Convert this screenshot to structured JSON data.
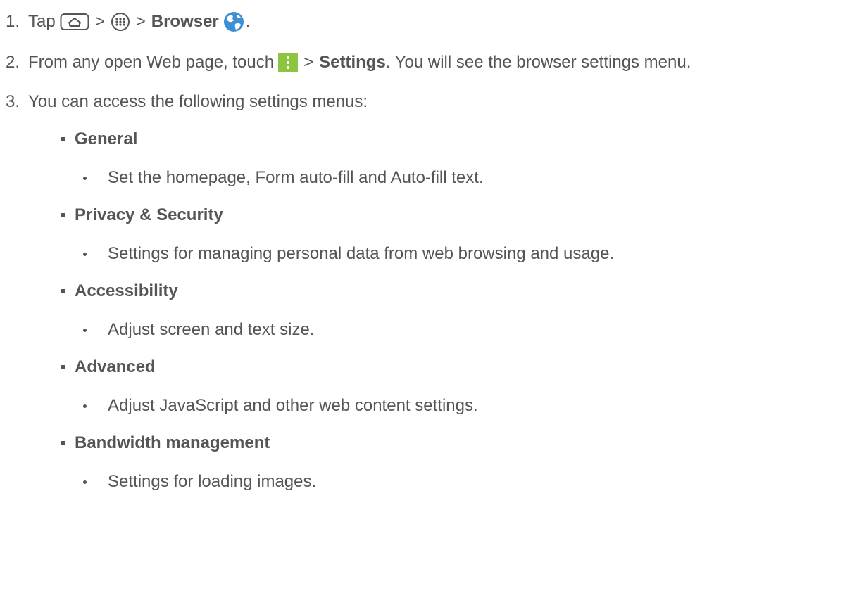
{
  "steps": [
    {
      "number": "1.",
      "tap": "Tap",
      "sep1": ">",
      "sep2": ">",
      "app_label": "Browser",
      "end": "."
    },
    {
      "number": "2.",
      "pre": "From any open Web page, touch",
      "sep": ">",
      "settings_label": "Settings",
      "post": ". You will see the browser settings menu."
    },
    {
      "number": "3.",
      "text": "You can access the following settings menus:"
    }
  ],
  "menus": [
    {
      "title": "General",
      "desc": "Set the homepage, Form auto-fill and Auto-fill text."
    },
    {
      "title": "Privacy & Security",
      "desc": "Settings for managing personal data from web browsing and usage."
    },
    {
      "title": "Accessibility",
      "desc": "Adjust screen and text size."
    },
    {
      "title": "Advanced",
      "desc": "Adjust JavaScript and other web content settings."
    },
    {
      "title": "Bandwidth management",
      "desc": "Settings for loading images."
    }
  ],
  "icons": {
    "home": "home-key-icon",
    "apps": "apps-icon",
    "browser": "browser-globe-icon",
    "menu": "menu-icon"
  },
  "colors": {
    "text": "#555555",
    "menu_icon_bg": "#8cc63f",
    "globe_blue": "#3c8fd6"
  }
}
